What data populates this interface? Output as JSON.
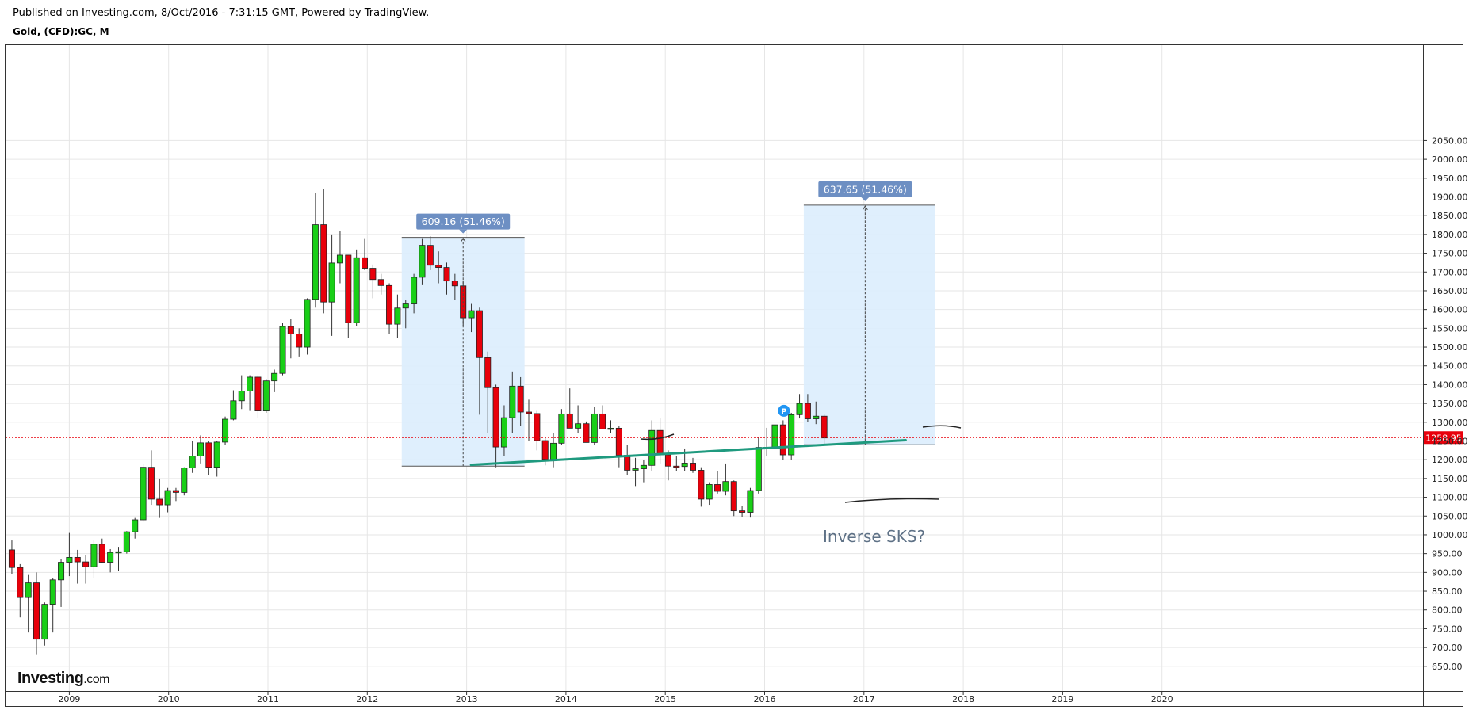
{
  "header": {
    "published": "Published on Investing.com, 8/Oct/2016 - 7:31:15 GMT, Powered by TradingView.",
    "symbol": "Gold, (CFD):GC, M"
  },
  "logo": {
    "text": "Investing",
    "suffix": ".com"
  },
  "colors": {
    "up": "#19cf17",
    "down": "#e8000b",
    "grid": "#e6e6e6",
    "trend": "#1f9a7f",
    "box": "#dcedfd",
    "badge": "#6d8fc3",
    "price": "#e8000b",
    "annotation": "#5e7186"
  },
  "chart_data": {
    "type": "candlestick",
    "ylim": [
      620,
      2060
    ],
    "y_ticks": [
      650,
      700,
      750,
      800,
      850,
      900,
      950,
      1000,
      1050,
      1100,
      1150,
      1200,
      1250,
      1300,
      1350,
      1400,
      1450,
      1500,
      1550,
      1600,
      1650,
      1700,
      1750,
      1800,
      1850,
      1900,
      1950,
      2000,
      2050
    ],
    "y_tick_labels": [
      "650.00",
      "700.00",
      "750.00",
      "800.00",
      "850.00",
      "900.00",
      "950.00",
      "1000.00",
      "1050.00",
      "1100.00",
      "1150.00",
      "1200.00",
      "1250.00",
      "1300.00",
      "1350.00",
      "1400.00",
      "1450.00",
      "1500.00",
      "1550.00",
      "1600.00",
      "1650.00",
      "1700.00",
      "1750.00",
      "1800.00",
      "1850.00",
      "1900.00",
      "1950.00",
      "2000.00",
      "2050.00"
    ],
    "x_tick_labels": [
      "2009",
      "2010",
      "2011",
      "2012",
      "2013",
      "2014",
      "2015",
      "2016",
      "2017",
      "2018",
      "2019",
      "2020"
    ],
    "start": "2008-06",
    "candles": [
      [
        960,
        985,
        895,
        913
      ],
      [
        913,
        922,
        780,
        833
      ],
      [
        833,
        893,
        740,
        872
      ],
      [
        872,
        900,
        682,
        722
      ],
      [
        722,
        820,
        705,
        815
      ],
      [
        815,
        885,
        740,
        880
      ],
      [
        880,
        935,
        808,
        927
      ],
      [
        927,
        1005,
        890,
        940
      ],
      [
        940,
        960,
        870,
        928
      ],
      [
        928,
        945,
        870,
        915
      ],
      [
        915,
        985,
        885,
        975
      ],
      [
        975,
        990,
        925,
        927
      ],
      [
        927,
        962,
        900,
        953
      ],
      [
        953,
        968,
        905,
        955
      ],
      [
        955,
        1010,
        950,
        1008
      ],
      [
        1008,
        1045,
        990,
        1040
      ],
      [
        1040,
        1190,
        1035,
        1180
      ],
      [
        1180,
        1225,
        1080,
        1095
      ],
      [
        1095,
        1150,
        1045,
        1080
      ],
      [
        1080,
        1125,
        1060,
        1118
      ],
      [
        1118,
        1125,
        1090,
        1113
      ],
      [
        1113,
        1180,
        1105,
        1178
      ],
      [
        1178,
        1250,
        1165,
        1210
      ],
      [
        1210,
        1265,
        1190,
        1245
      ],
      [
        1245,
        1250,
        1160,
        1180
      ],
      [
        1180,
        1250,
        1155,
        1247
      ],
      [
        1247,
        1315,
        1240,
        1308
      ],
      [
        1308,
        1385,
        1305,
        1357
      ],
      [
        1357,
        1425,
        1335,
        1383
      ],
      [
        1383,
        1425,
        1330,
        1420
      ],
      [
        1420,
        1425,
        1310,
        1330
      ],
      [
        1330,
        1415,
        1325,
        1410
      ],
      [
        1410,
        1440,
        1380,
        1430
      ],
      [
        1430,
        1565,
        1425,
        1555
      ],
      [
        1555,
        1575,
        1470,
        1535
      ],
      [
        1535,
        1550,
        1475,
        1500
      ],
      [
        1500,
        1630,
        1480,
        1627
      ],
      [
        1627,
        1910,
        1605,
        1826
      ],
      [
        1826,
        1920,
        1590,
        1620
      ],
      [
        1620,
        1800,
        1530,
        1724
      ],
      [
        1724,
        1810,
        1670,
        1745
      ],
      [
        1745,
        1745,
        1525,
        1565
      ],
      [
        1565,
        1760,
        1555,
        1738
      ],
      [
        1738,
        1790,
        1705,
        1710
      ],
      [
        1710,
        1720,
        1630,
        1680
      ],
      [
        1680,
        1695,
        1640,
        1664
      ],
      [
        1664,
        1670,
        1535,
        1561
      ],
      [
        1561,
        1640,
        1525,
        1604
      ],
      [
        1604,
        1625,
        1550,
        1615
      ],
      [
        1615,
        1695,
        1590,
        1686
      ],
      [
        1686,
        1790,
        1665,
        1771
      ],
      [
        1771,
        1795,
        1705,
        1718
      ],
      [
        1718,
        1755,
        1670,
        1712
      ],
      [
        1712,
        1725,
        1640,
        1676
      ],
      [
        1676,
        1695,
        1625,
        1663
      ],
      [
        1663,
        1675,
        1555,
        1578
      ],
      [
        1578,
        1615,
        1540,
        1597
      ],
      [
        1597,
        1605,
        1320,
        1472
      ],
      [
        1472,
        1488,
        1270,
        1392
      ],
      [
        1392,
        1400,
        1180,
        1234
      ],
      [
        1234,
        1345,
        1210,
        1312
      ],
      [
        1312,
        1435,
        1270,
        1396
      ],
      [
        1396,
        1420,
        1290,
        1327
      ],
      [
        1327,
        1360,
        1250,
        1323
      ],
      [
        1323,
        1330,
        1225,
        1251
      ],
      [
        1251,
        1260,
        1185,
        1201
      ],
      [
        1201,
        1270,
        1180,
        1244
      ],
      [
        1244,
        1335,
        1240,
        1322
      ],
      [
        1322,
        1390,
        1285,
        1284
      ],
      [
        1284,
        1345,
        1270,
        1296
      ],
      [
        1296,
        1302,
        1255,
        1246
      ],
      [
        1246,
        1340,
        1240,
        1322
      ],
      [
        1322,
        1345,
        1285,
        1282
      ],
      [
        1282,
        1305,
        1270,
        1284
      ],
      [
        1284,
        1290,
        1180,
        1212
      ],
      [
        1212,
        1240,
        1160,
        1172
      ],
      [
        1172,
        1205,
        1130,
        1176
      ],
      [
        1176,
        1200,
        1140,
        1185
      ],
      [
        1185,
        1305,
        1170,
        1278
      ],
      [
        1278,
        1310,
        1190,
        1213
      ],
      [
        1213,
        1225,
        1145,
        1183
      ],
      [
        1183,
        1210,
        1170,
        1182
      ],
      [
        1182,
        1230,
        1170,
        1191
      ],
      [
        1191,
        1205,
        1165,
        1172
      ],
      [
        1172,
        1180,
        1075,
        1095
      ],
      [
        1095,
        1140,
        1080,
        1134
      ],
      [
        1134,
        1170,
        1110,
        1116
      ],
      [
        1116,
        1190,
        1105,
        1142
      ],
      [
        1142,
        1145,
        1050,
        1064
      ],
      [
        1064,
        1078,
        1048,
        1060
      ],
      [
        1060,
        1125,
        1046,
        1118
      ],
      [
        1118,
        1260,
        1110,
        1233
      ],
      [
        1233,
        1285,
        1210,
        1232
      ],
      [
        1232,
        1302,
        1210,
        1293
      ],
      [
        1293,
        1305,
        1200,
        1213
      ],
      [
        1213,
        1325,
        1200,
        1320
      ],
      [
        1320,
        1375,
        1310,
        1350
      ],
      [
        1350,
        1375,
        1300,
        1309
      ],
      [
        1309,
        1355,
        1295,
        1316
      ],
      [
        1316,
        1320,
        1241,
        1258
      ]
    ],
    "last_price": "1258.95",
    "projections": [
      {
        "label": "609.16 (51.46%)",
        "from": "2012-06",
        "to": "2013-08",
        "low": 1183,
        "high": 1792,
        "mid": "2013-01"
      },
      {
        "label": "637.65 (51.46%)",
        "from": "2016-07",
        "to": "2017-10",
        "low": 1240,
        "high": 1878,
        "mid": "2017-02"
      }
    ],
    "trendline": {
      "from": [
        "2013-01",
        1178
      ],
      "to": [
        "2017-05",
        1252
      ]
    },
    "marker": {
      "label": "P",
      "date": "2016-04",
      "price": 1343
    },
    "annotation": "Inverse SKS?"
  }
}
